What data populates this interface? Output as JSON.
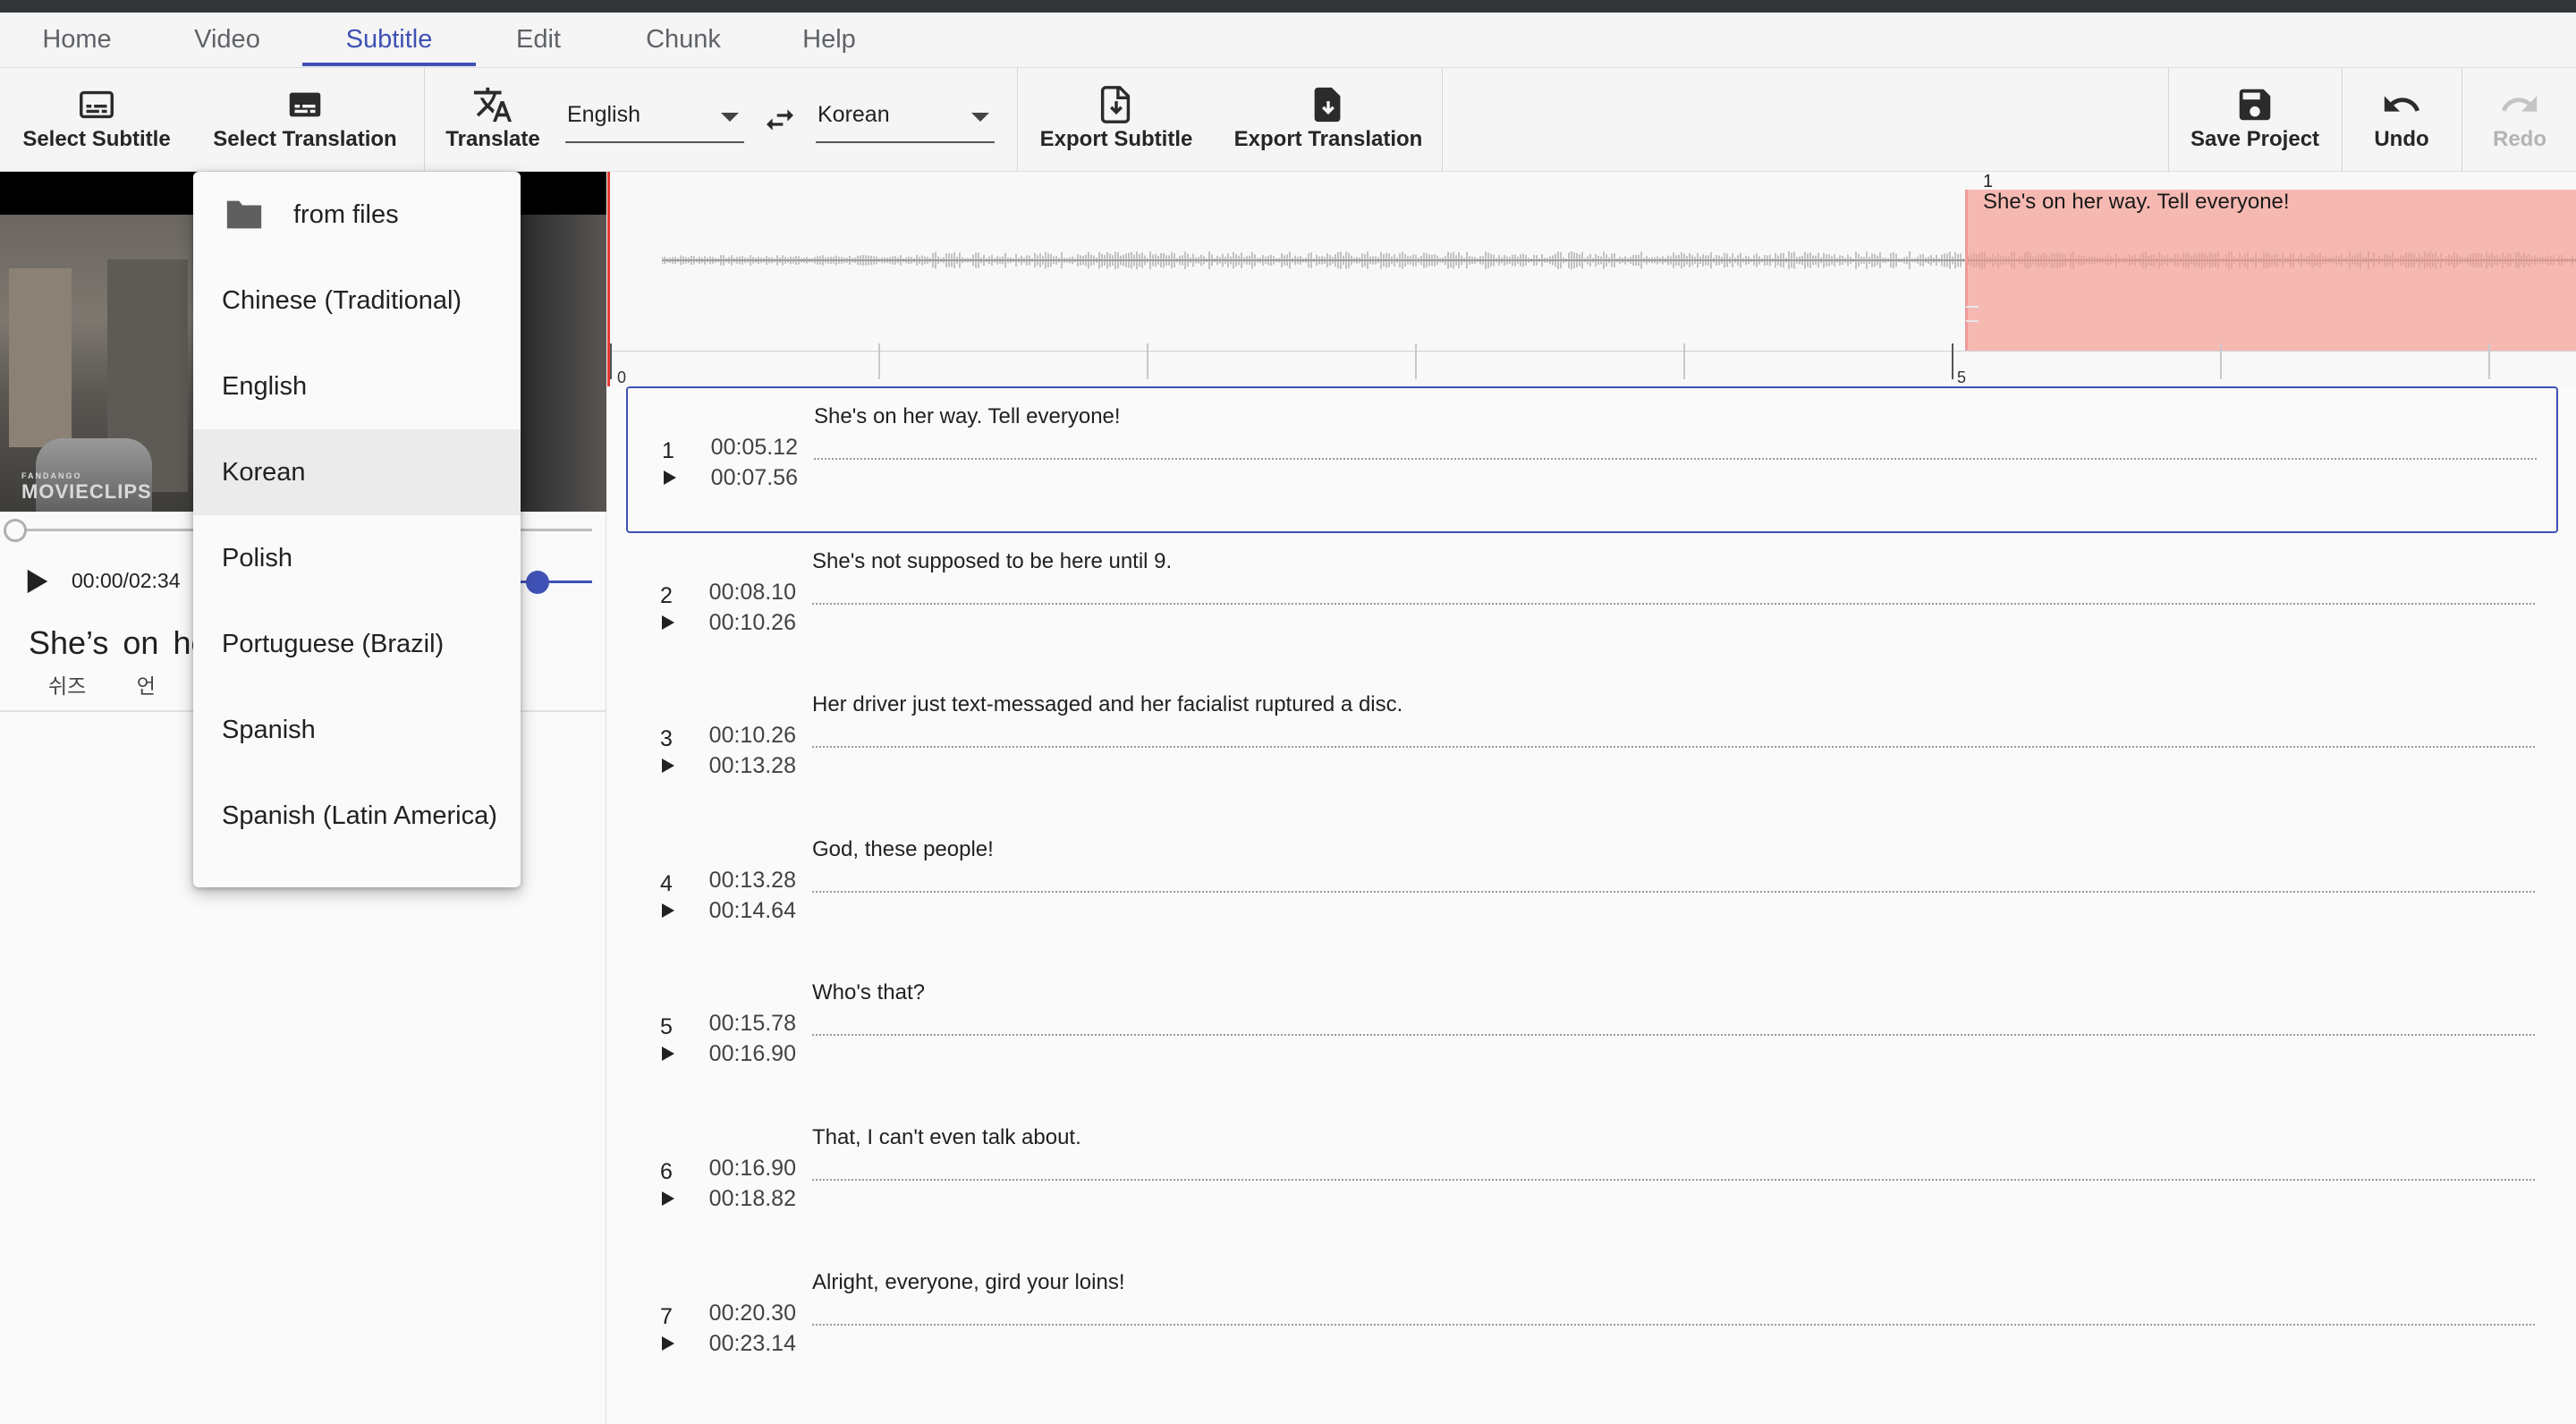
{
  "menu": {
    "tabs": [
      {
        "label": "Home"
      },
      {
        "label": "Video"
      },
      {
        "label": "Subtitle"
      },
      {
        "label": "Edit"
      },
      {
        "label": "Chunk"
      },
      {
        "label": "Help"
      }
    ],
    "active": "Subtitle"
  },
  "toolbar": {
    "select_subtitle": "Select Subtitle",
    "select_translation": "Select Translation",
    "translate": "Translate",
    "source_lang": "English",
    "target_lang": "Korean",
    "export_subtitle": "Export Subtitle",
    "export_translation": "Export Translation",
    "save_project": "Save Project",
    "undo": "Undo",
    "redo": "Redo"
  },
  "player": {
    "time": "00:00/02:34",
    "current_subtitle": "She’s on he",
    "current_translation": "쉬즈 언 ㅎ",
    "watermark_top": "FANDANGO",
    "watermark": "MOVIECLIPS",
    "volume": 0.4,
    "progress": 0.0
  },
  "dropdown": {
    "items": [
      {
        "label": "from files",
        "icon": "folder-icon"
      },
      {
        "label": "Chinese (Traditional)"
      },
      {
        "label": "English"
      },
      {
        "label": "Korean"
      },
      {
        "label": "Polish"
      },
      {
        "label": "Portuguese (Brazil)"
      },
      {
        "label": "Spanish"
      },
      {
        "label": "Spanish (Latin America)"
      }
    ],
    "highlighted": "Korean"
  },
  "waveform": {
    "region_index": "1",
    "region_text": "She's on her way. Tell everyone!",
    "ruler_labels": [
      "0",
      "5"
    ]
  },
  "subtitles": [
    {
      "num": "1",
      "start": "00:05.12",
      "end": "00:07.56",
      "text": "She's on her way. Tell everyone!"
    },
    {
      "num": "2",
      "start": "00:08.10",
      "end": "00:10.26",
      "text": "She's not supposed to be here until 9."
    },
    {
      "num": "3",
      "start": "00:10.26",
      "end": "00:13.28",
      "text": "Her driver just text-messaged and her facialist ruptured a disc."
    },
    {
      "num": "4",
      "start": "00:13.28",
      "end": "00:14.64",
      "text": "God, these people!"
    },
    {
      "num": "5",
      "start": "00:15.78",
      "end": "00:16.90",
      "text": "Who's that?"
    },
    {
      "num": "6",
      "start": "00:16.90",
      "end": "00:18.82",
      "text": "That, I can't even talk about."
    },
    {
      "num": "7",
      "start": "00:20.30",
      "end": "00:23.14",
      "text": "Alright, everyone, gird your loins!"
    }
  ],
  "colors": {
    "accent": "#3f51b5",
    "region": "#f4968c",
    "cursor": "#e53935"
  }
}
